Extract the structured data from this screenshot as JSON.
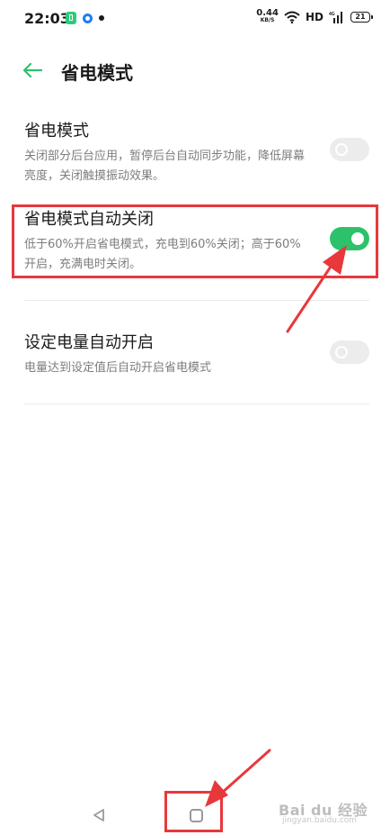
{
  "status_bar": {
    "time": "22:03",
    "net_speed_value": "0.44",
    "net_speed_unit": "KB/S",
    "hd": "HD",
    "battery": "21"
  },
  "header": {
    "title": "省电模式"
  },
  "settings": [
    {
      "title": "省电模式",
      "description": "关闭部分后台应用，暂停后台自动同步功能，降低屏幕亮度，关闭触摸振动效果。",
      "enabled": false
    },
    {
      "title": "省电模式自动关闭",
      "description": "低于60%开启省电模式，充电到60%关闭；高于60%开启，充满电时关闭。",
      "enabled": true
    },
    {
      "title": "设定电量自动开启",
      "description": "电量达到设定值后自动开启省电模式",
      "enabled": false
    }
  ],
  "watermark": {
    "text": "Bai du 经验",
    "sub": "jingyan.baidu.com"
  },
  "colors": {
    "accent": "#2ec16b",
    "annotation_red": "#e8383c"
  }
}
